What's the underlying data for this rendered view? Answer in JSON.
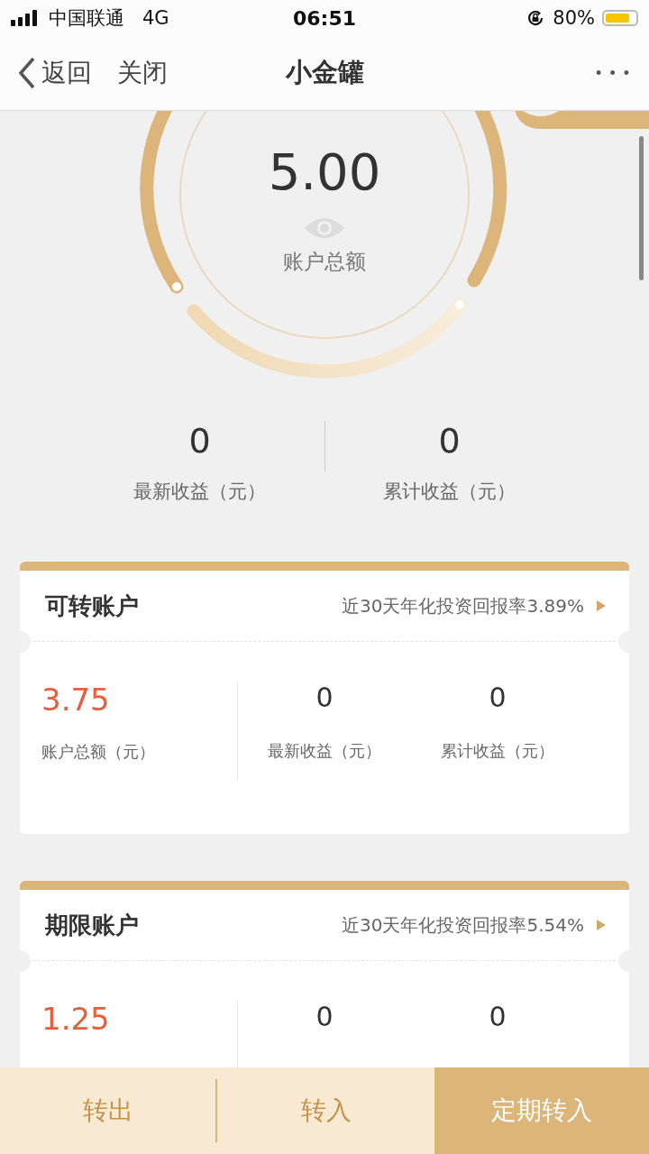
{
  "status_bar": {
    "carrier": "中国联通",
    "network": "4G",
    "time": "06:51",
    "battery_text": "80%"
  },
  "nav": {
    "back": "返回",
    "close": "关闭",
    "title": "小金罐",
    "more": "• • •"
  },
  "gauge": {
    "amount": "5.00",
    "label": "账户总额"
  },
  "summary": [
    {
      "value": "0",
      "label": "最新收益（元）"
    },
    {
      "value": "0",
      "label": "累计收益（元）"
    }
  ],
  "accounts": [
    {
      "title": "可转账户",
      "rate": "近30天年化投资回报率3.89%",
      "total": "3.75",
      "total_label": "账户总额（元）",
      "stats": [
        {
          "value": "0",
          "label": "最新收益（元）"
        },
        {
          "value": "0",
          "label": "累计收益（元）"
        }
      ]
    },
    {
      "title": "期限账户",
      "rate": "近30天年化投资回报率5.54%",
      "total": "1.25",
      "stats": [
        {
          "value": "0"
        },
        {
          "value": "0"
        }
      ]
    }
  ],
  "bottom_bar": [
    {
      "label": "转出",
      "kind": "plain"
    },
    {
      "label": "转入",
      "kind": "plain"
    },
    {
      "label": "定期转入",
      "kind": "primary"
    }
  ]
}
